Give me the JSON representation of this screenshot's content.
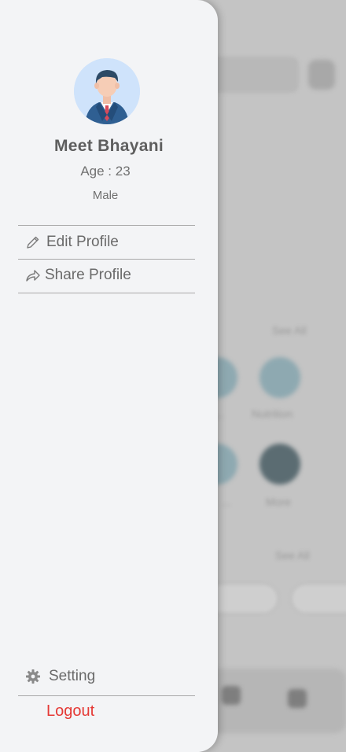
{
  "profile": {
    "name": "Meet Bhayani",
    "age": "Age : 23",
    "gender": "Male"
  },
  "menu": {
    "edit_profile": "Edit Profile",
    "share_profile": "Share Profile",
    "setting": "Setting",
    "logout": "Logout"
  },
  "colors": {
    "logout": "#e53935",
    "drawer_bg": "#f3f4f6"
  },
  "icons": {
    "edit": "pencil-icon",
    "share": "share-icon",
    "setting": "gear-icon"
  }
}
